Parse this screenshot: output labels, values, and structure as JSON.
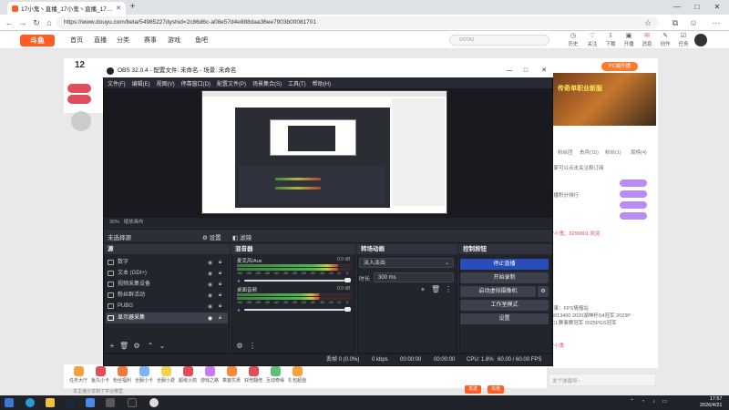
{
  "browser": {
    "tab_title": "17小鬼丶直播_17小鬼丶直播_17小鬼",
    "url": "https://www.douyu.com/beta/54985227dyshid=2c86d6c-a08e57d4e888daa36ee7903b00081701"
  },
  "douyu": {
    "logo": "斗鱼",
    "nav": [
      "首页",
      "直播",
      "分类",
      "赛事",
      "游戏",
      "鱼吧"
    ],
    "search_placeholder": "DOTA2",
    "header_icons": [
      "历史",
      "关注",
      "下载",
      "开播",
      "消息",
      "创作",
      "任务"
    ],
    "room_number": "12",
    "pc_button": "PC端开播",
    "banner_text": "传奇单职业新服",
    "chat_tabs": [
      "粉丝团",
      "贵宾(15)",
      "粉丝(1)",
      "周榜(4)"
    ],
    "chat_lines": [
      "大家可以点击关注和订阅",
      "主播积分排行",
      "17小鬼：6290001 欢迎",
      "赛事：FPS情报站",
      "86013400 2020湖神杯S4冠军 2023P",
      "PCL赛事赛冠军 2025PGS冠军",
      "17小鬼"
    ],
    "chat_input_placeholder": "发个弹幕呗~",
    "gifts": [
      "任务大厅",
      "鱼丸小卡",
      "粉丝福利",
      "全服小卡",
      "全服小费",
      "超级火箭",
      "游戏之路",
      "乘客优惠",
      "双倍翻倍",
      "互动奇缘",
      "礼包超值"
    ],
    "footer_text": "本主播分享到了平台哪里",
    "send_buttons": [
      "发送",
      "充值"
    ]
  },
  "obs": {
    "title": "OBS 32.0.4 - 配置文件: 未命名 - 场景: 未命名",
    "menu": [
      "文件(F)",
      "编辑(E)",
      "视图(V)",
      "停靠窗口(D)",
      "配置文件(P)",
      "场景集合(S)",
      "工具(T)",
      "帮助(H)"
    ],
    "zoom": "30%",
    "zoom_label": "缩放画布",
    "no_source": "未选择源",
    "properties_btn": "设置",
    "filters_btn": "滤镜",
    "sources_dock": {
      "title": "源",
      "items": [
        {
          "name": "数字",
          "selected": false
        },
        {
          "name": "文本 (GDI+)",
          "selected": false
        },
        {
          "name": "视频采集设备",
          "selected": false
        },
        {
          "name": "粉丝群活动",
          "selected": false
        },
        {
          "name": "PUBG",
          "selected": false
        },
        {
          "name": "显示器采集",
          "selected": true
        }
      ]
    },
    "mixer_dock": {
      "title": "混音器",
      "channels": [
        {
          "name": "麦克风/Aux",
          "db": "0.0 dB",
          "level": 0.88
        },
        {
          "name": "桌面音频",
          "db": "0.0 dB",
          "level": 0.72
        }
      ],
      "scale": [
        "-60",
        "-55",
        "-50",
        "-45",
        "-40",
        "-35",
        "-30",
        "-25",
        "-20",
        "-15",
        "-10",
        "-5",
        "0"
      ]
    },
    "transitions_dock": {
      "title": "转场动画",
      "transition": "淡入淡出",
      "duration_label": "时长",
      "duration": "300 ms"
    },
    "controls_dock": {
      "title": "控制按钮",
      "buttons": [
        "停止直播",
        "开始录制",
        "启动虚拟摄像机",
        "工作室模式",
        "设置"
      ]
    },
    "status": {
      "dropped": "丢帧 0 (0.0%)",
      "kbps": "0 kbps",
      "stream_time": "00:00:00",
      "rec_time": "00:00:00",
      "cpu": "CPU: 1.8%",
      "fps": "60.00 / 60.00 FPS"
    }
  },
  "taskbar": {
    "time": "17:57",
    "date": "2026/4/21"
  }
}
